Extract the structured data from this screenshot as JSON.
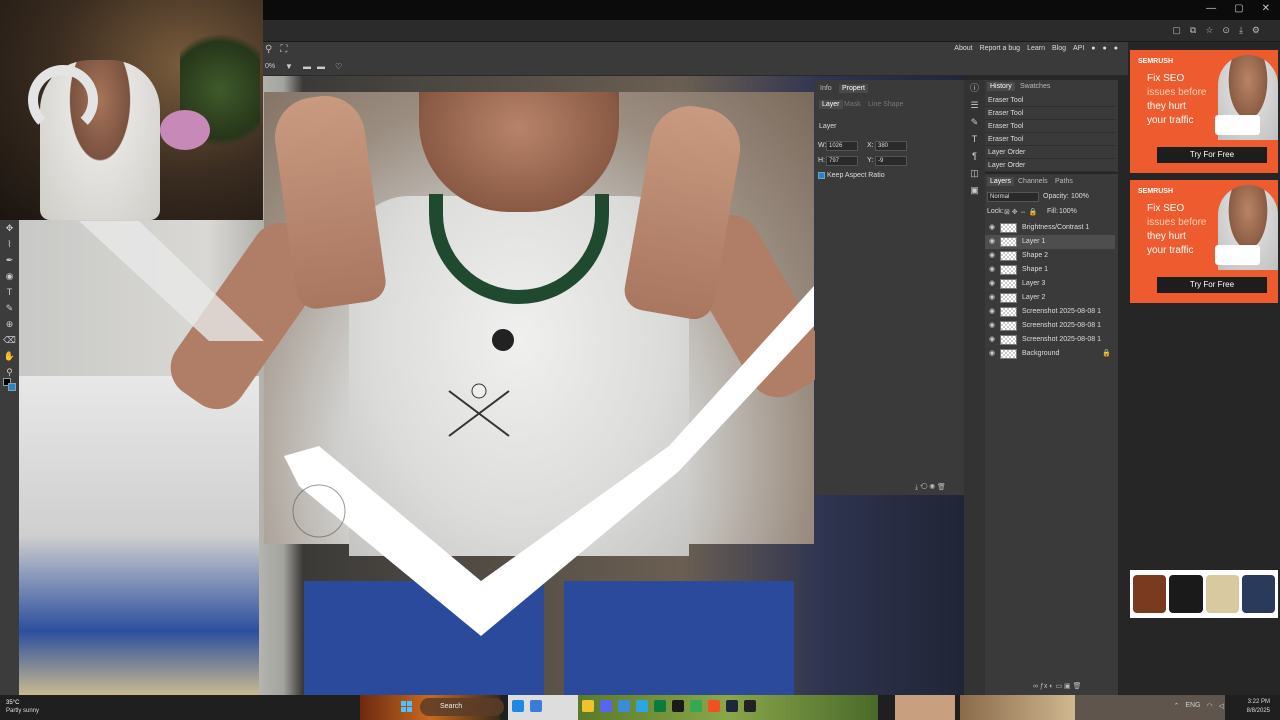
{
  "browser": {
    "window_controls": [
      "—",
      "▢",
      "✕"
    ],
    "toolbar_icons": [
      "▢",
      "⧉",
      "☆",
      "⊙",
      "⤓",
      "⚙"
    ]
  },
  "app": {
    "menu_links": [
      "About",
      "Report a bug",
      "Learn",
      "Blog",
      "API"
    ],
    "zoom_value": "0%"
  },
  "panels": {
    "properties": {
      "tabs": [
        "Info",
        "Propert"
      ],
      "subtabs": [
        "Layer",
        "Mask",
        "Line Shape"
      ],
      "section_title": "Layer",
      "w_label": "W:",
      "w_value": "1026",
      "x_label": "X:",
      "x_value": "380",
      "h_label": "H:",
      "h_value": "797",
      "y_label": "Y:",
      "y_value": "-9",
      "keep_aspect_label": "Keep Aspect Ratio"
    },
    "history": {
      "tabs": [
        "History",
        "Swatches"
      ],
      "items": [
        "Eraser Tool",
        "Eraser Tool",
        "Eraser Tool",
        "Eraser Tool",
        "Layer Order",
        "Layer Order"
      ]
    },
    "layers": {
      "tabs": [
        "Layers",
        "Channels",
        "Paths"
      ],
      "blend_mode": "Normal",
      "opacity_label": "Opacity:",
      "opacity_value": "100%",
      "lock_label": "Lock:",
      "fill_label": "Fill:",
      "fill_value": "100%",
      "items": [
        {
          "name": "Brightness/Contrast 1",
          "selected": false
        },
        {
          "name": "Layer 1",
          "selected": true
        },
        {
          "name": "Shape 2",
          "selected": false
        },
        {
          "name": "Shape 1",
          "selected": false
        },
        {
          "name": "Layer 3",
          "selected": false
        },
        {
          "name": "Layer 2",
          "selected": false
        },
        {
          "name": "Screenshot 2025-08-08 1",
          "selected": false
        },
        {
          "name": "Screenshot 2025-08-08 1",
          "selected": false
        },
        {
          "name": "Screenshot 2025-08-08 1",
          "selected": false
        },
        {
          "name": "Background",
          "selected": false
        }
      ]
    }
  },
  "ads": [
    {
      "brand": "SEMRUSH",
      "headline_a": "Fix SEO",
      "headline_b": "issues before",
      "headline_c": "they hurt",
      "headline_d": "your traffic",
      "cta": "Try For Free"
    },
    {
      "brand": "SEMRUSH",
      "headline_a": "Fix SEO",
      "headline_b": "issues before",
      "headline_c": "they hurt",
      "headline_d": "your traffic",
      "cta": "Try For Free"
    }
  ],
  "taskbar": {
    "temperature": "35°C",
    "weather": "Partly sunny",
    "search_placeholder": "Search",
    "lang": "ENG",
    "time": "3:22 PM",
    "date": "8/8/2025"
  },
  "colors": {
    "accent": "#2b7fd4",
    "ad_orange": "#ee5b2f",
    "panel_bg": "#3a3a3a"
  }
}
